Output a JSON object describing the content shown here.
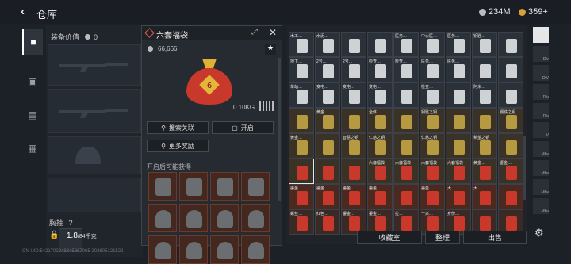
{
  "header": {
    "title": "仓库",
    "currency1": "234M",
    "currency2": "359+"
  },
  "left_tabs": [
    {
      "icon": "pistol-icon"
    },
    {
      "icon": "vest-icon"
    },
    {
      "icon": "backpack-icon"
    },
    {
      "icon": "briefcase-icon"
    }
  ],
  "equipment": {
    "value_label": "装备价值",
    "value": "0",
    "chest_label": "胸挂",
    "chest_hint": "?",
    "weight": "1.8",
    "weight_max": "/84千克"
  },
  "popup": {
    "name": "六套福袋",
    "value": "66,666",
    "weight": "0.10KG",
    "search_btn": "搜索关联",
    "open_btn": "开启",
    "more_btn": "更多奖励",
    "note": "开启后可能获得"
  },
  "inventory": {
    "labels": [
      "木工…",
      "水泥…",
      "",
      "",
      "医务…",
      "中心医…",
      "医务…",
      "钥匙…",
      "",
      "地下…",
      "2号…",
      "2号…",
      "检查…",
      "检查…",
      "医务…",
      "医务…",
      "",
      "",
      "车站…",
      "变电…",
      "变电…",
      "变电…",
      "",
      "检查…",
      "",
      "阿米…",
      "",
      "",
      "黄金…",
      "",
      "全体…",
      "",
      "钥匙之钥",
      "",
      "",
      "钢铁之钥",
      "黄金…",
      "",
      "智慧之钥",
      "仁慈之钥",
      "",
      "仁慈之钥",
      "",
      "希望之钥",
      "",
      "",
      "",
      "",
      "六套福袋",
      "六套福袋",
      "六套福袋",
      "六套福袋",
      "黄金…",
      "鎏金…",
      "鎏金…",
      "鎏金…",
      "鎏金…",
      "鎏金…",
      "",
      "鎏金…",
      "大…",
      "大…",
      "",
      "螺丝…",
      "红色…",
      "鎏金…",
      "鎏金…",
      "拉…",
      "干兴…",
      "身份…",
      "",
      "",
      "",
      "",
      "",
      ""
    ]
  },
  "rtab_labels": [
    "",
    "Dlv",
    "DlV",
    "Dlv",
    "Dlv",
    "V",
    "Mbv",
    "Mbv",
    "Mbv",
    "Mbv"
  ],
  "actions": {
    "storage": "收藏室",
    "organize": "整理",
    "sell": "出售"
  },
  "footer": "CN UID:5421702948345867065 202605121522",
  "colors": {
    "accent": "#d8a23a",
    "red_bag": "#c8392b",
    "gold": "#d4b040"
  }
}
